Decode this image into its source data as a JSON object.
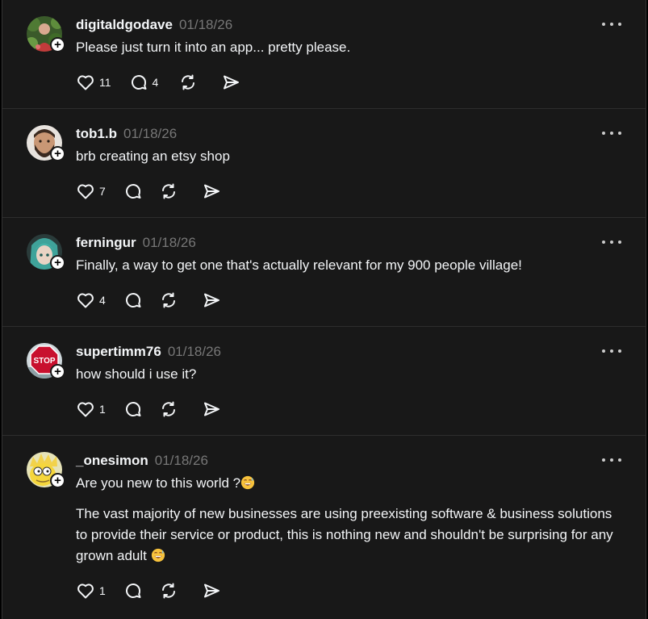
{
  "replies": [
    {
      "username": "digitaldgodave",
      "timestamp": "01/18/26",
      "text": "Please just turn it into an app... pretty please.",
      "likes": "11",
      "comments": "4",
      "avatar_icon": "person-with-plants-avatar"
    },
    {
      "username": "tob1.b",
      "timestamp": "01/18/26",
      "text": "brb creating an etsy shop",
      "likes": "7",
      "comments": "",
      "avatar_icon": "bearded-man-avatar"
    },
    {
      "username": "ferningur",
      "timestamp": "01/18/26",
      "text": "Finally, a way to get one that's actually relevant for my 900 people village!",
      "likes": "4",
      "comments": "",
      "avatar_icon": "anime-character-avatar"
    },
    {
      "username": "supertimm76",
      "timestamp": "01/18/26",
      "text": "how should i use it?",
      "likes": "1",
      "comments": "",
      "avatar_icon": "stop-sign-avatar",
      "avatar_text": "STOP"
    },
    {
      "username": "_onesimon",
      "timestamp": "01/18/26",
      "text": "Are you new to this world ?",
      "text2": "The vast majority of new businesses are using preexisting software & business solutions to provide their service or product, this is nothing new and shouldn't be surprising for any grown adult ",
      "likes": "1",
      "comments": "",
      "avatar_icon": "cartoon-character-avatar"
    }
  ],
  "colors": {
    "background": "#181818",
    "text": "#f3f5f7",
    "muted": "#777777",
    "divider": "#2d2d2d"
  },
  "icons": {
    "like": "heart-icon",
    "comment": "comment-bubble-icon",
    "repost": "repost-icon",
    "share": "send-icon",
    "more": "more-options-icon",
    "follow": "plus-icon",
    "emoji": "grinning-sweat-emoji"
  }
}
